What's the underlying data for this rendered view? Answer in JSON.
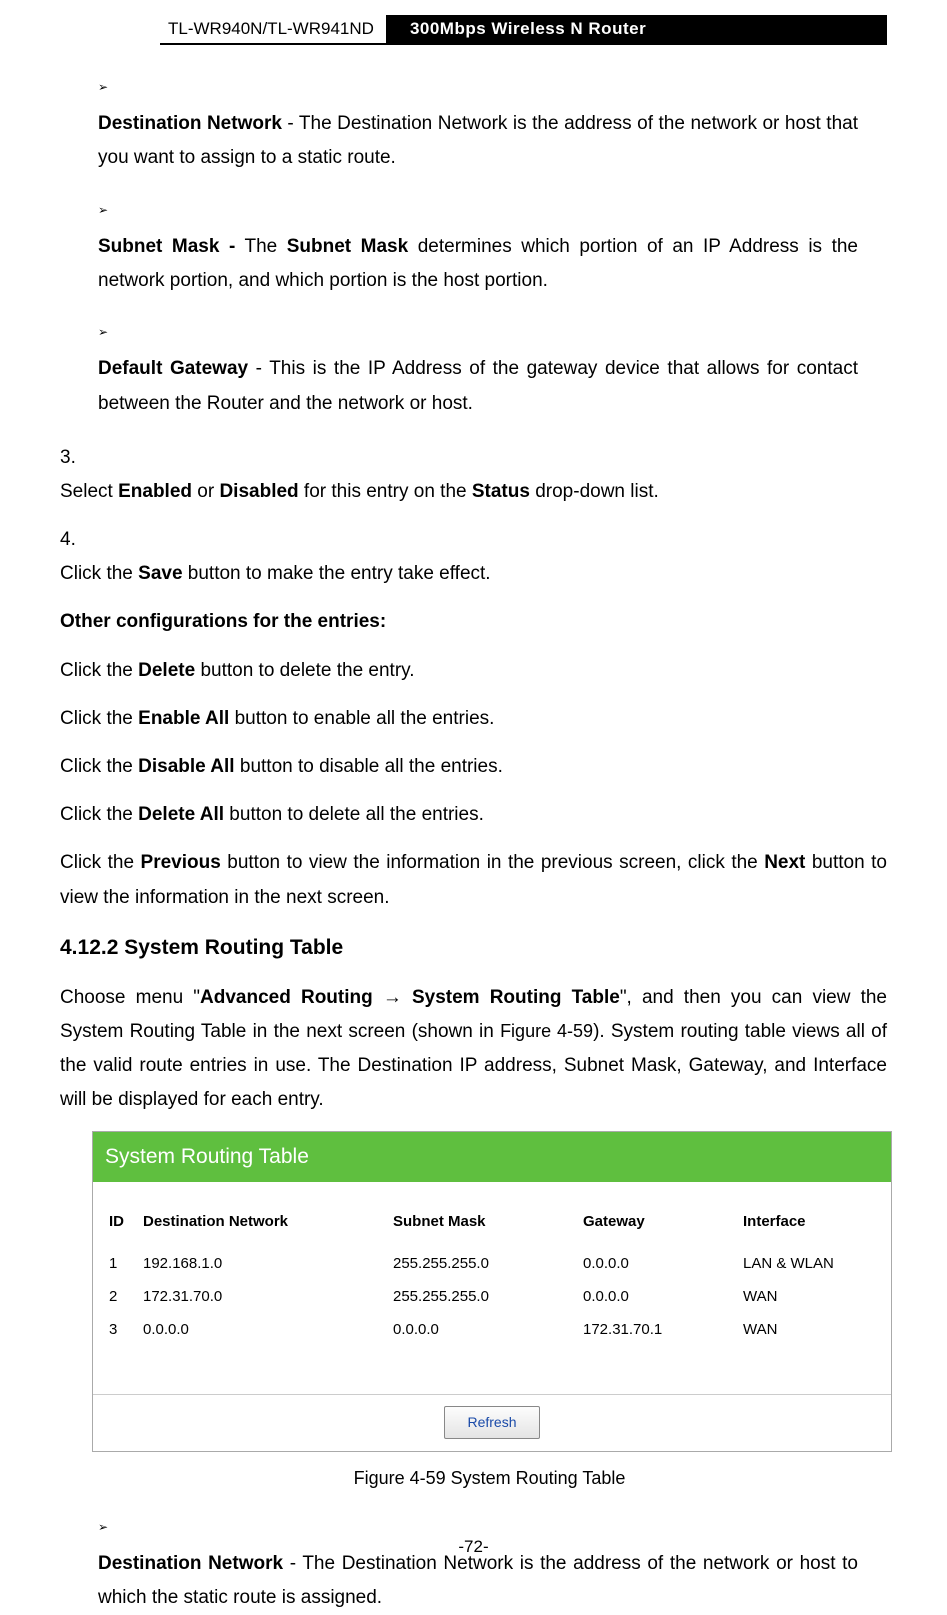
{
  "header": {
    "left": "TL-WR940N/TL-WR941ND",
    "right": "300Mbps Wireless N Router"
  },
  "bullets1": [
    {
      "term": "Destination Network",
      "sep": " - ",
      "desc": "The Destination Network is the address of the network or host that you want to assign to a static route."
    },
    {
      "term": "Subnet Mask -",
      "sep": " The ",
      "mid_bold": "Subnet Mask",
      "desc2": " determines which portion of an IP Address is the network portion, and which portion is the host portion."
    },
    {
      "term": "Default Gateway",
      "sep": " - ",
      "desc": "This is the IP Address of the gateway device that allows for contact between the Router and the network or host."
    }
  ],
  "steps": [
    {
      "n": "3.",
      "pre": "Select ",
      "b1": "Enabled",
      "mid1": " or ",
      "b2": "Disabled",
      "mid2": " for this entry on the ",
      "b3": "Status",
      "post": " drop-down list."
    },
    {
      "n": "4.",
      "pre": "Click the ",
      "b1": "Save",
      "post": " button to make the entry take effect."
    }
  ],
  "subheading": "Other configurations for the entries:",
  "paras": [
    {
      "pre": "Click the ",
      "b": "Delete",
      "post": " button to delete the entry."
    },
    {
      "pre": "Click the ",
      "b": "Enable All",
      "post": " button to enable all the entries."
    },
    {
      "pre": "Click the ",
      "b": "Disable All",
      "post": " button to disable all the entries."
    },
    {
      "pre": "Click the ",
      "b": "Delete All",
      "post": " button to delete all the entries."
    }
  ],
  "prevnext": {
    "pre": "Click the ",
    "b1": "Previous",
    "mid": " button to view the information in the previous screen, click the ",
    "b2": "Next",
    "post": " button to view the information in the next screen."
  },
  "section": "4.12.2 System Routing Table",
  "intro": {
    "p1a": "Choose menu \"",
    "p1b": "Advanced Routing → System Routing Table",
    "p1c": "\", and then you can view the System Routing Table in the next screen (shown in ",
    "figref": "Figure 4-59",
    "p1d": "). System routing table views all of the valid route entries in use. The Destination IP address, Subnet Mask, Gateway, and Interface will be displayed for each entry."
  },
  "figure": {
    "title": "System Routing Table",
    "columns": {
      "id": "ID",
      "dest": "Destination Network",
      "mask": "Subnet Mask",
      "gw": "Gateway",
      "iface": "Interface"
    },
    "rows": [
      {
        "id": "1",
        "dest": "192.168.1.0",
        "mask": "255.255.255.0",
        "gw": "0.0.0.0",
        "iface": "LAN & WLAN"
      },
      {
        "id": "2",
        "dest": "172.31.70.0",
        "mask": "255.255.255.0",
        "gw": "0.0.0.0",
        "iface": "WAN"
      },
      {
        "id": "3",
        "dest": "0.0.0.0",
        "mask": "0.0.0.0",
        "gw": "172.31.70.1",
        "iface": "WAN"
      }
    ],
    "button": "Refresh",
    "caption": "Figure 4-59    System Routing Table"
  },
  "bullets2": [
    {
      "term": "Destination Network",
      "sep": " - ",
      "desc": "The Destination Network is the address of the network or host to which the static route is assigned."
    }
  ],
  "pagenum": "-72-"
}
